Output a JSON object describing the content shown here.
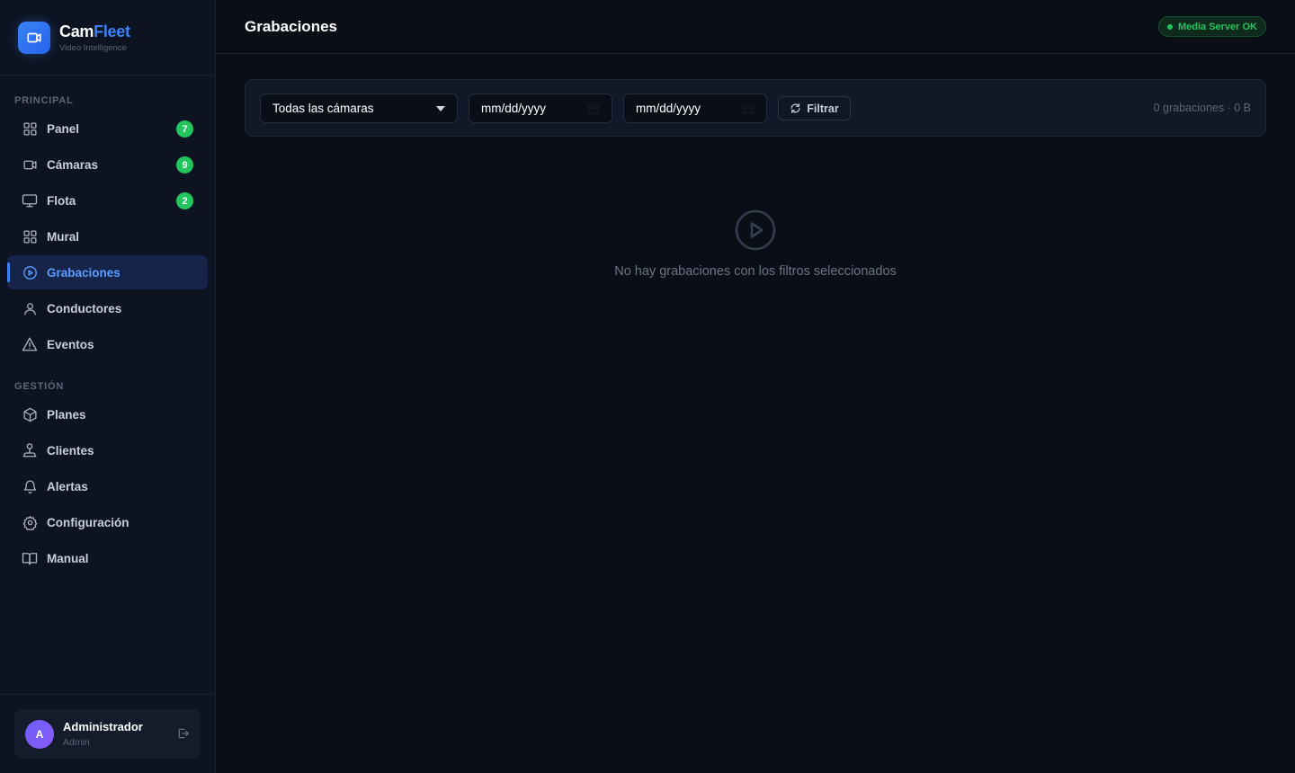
{
  "brand": {
    "name_prefix": "Cam",
    "name_accent": "Fleet",
    "subtitle": "Video Intelligence",
    "icon": "camera-icon"
  },
  "sidebar": {
    "sections": [
      {
        "title": "PRINCIPAL",
        "items": [
          {
            "label": "Panel",
            "icon": "grid-icon",
            "badge": "7"
          },
          {
            "label": "Cámaras",
            "icon": "camera-icon",
            "badge": "9"
          },
          {
            "label": "Flota",
            "icon": "monitor-icon",
            "badge": "2"
          },
          {
            "label": "Mural",
            "icon": "grid-icon"
          },
          {
            "label": "Grabaciones",
            "icon": "play-circle-icon",
            "active": true
          },
          {
            "label": "Conductores",
            "icon": "user-icon"
          },
          {
            "label": "Eventos",
            "icon": "warning-icon"
          }
        ]
      },
      {
        "title": "GESTIÓN",
        "items": [
          {
            "label": "Planes",
            "icon": "box-icon"
          },
          {
            "label": "Clientes",
            "icon": "network-icon"
          },
          {
            "label": "Alertas",
            "icon": "bell-icon"
          },
          {
            "label": "Configuración",
            "icon": "gear-icon"
          },
          {
            "label": "Manual",
            "icon": "book-icon"
          }
        ]
      }
    ],
    "user": {
      "initial": "A",
      "name": "Administrador",
      "role": "Admin"
    }
  },
  "header": {
    "title": "Grabaciones",
    "status": "Media Server OK",
    "status_color": "#22c55e"
  },
  "filters": {
    "camera_select": "Todas las cámaras",
    "date_from": "mm/dd/yyyy",
    "date_to": "mm/dd/yyyy",
    "filter_button": "Filtrar",
    "summary": "0 grabaciones · 0 B"
  },
  "empty_state": {
    "message": "No hay grabaciones con los filtros seleccionados",
    "icon": "play-circle-icon"
  },
  "colors": {
    "accent": "#3b82f6",
    "success": "#22c55e",
    "background": "#0a0e17"
  }
}
